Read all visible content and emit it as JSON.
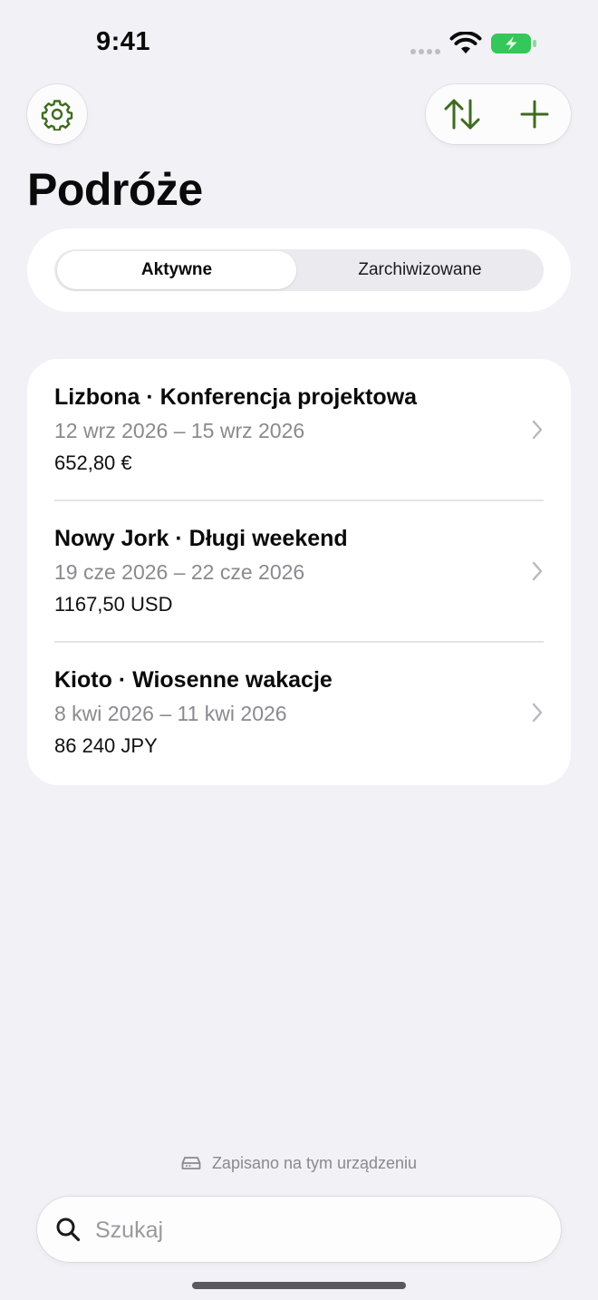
{
  "status_bar": {
    "time": "9:41"
  },
  "header": {
    "title": "Podróże",
    "settings_icon": "gear-icon",
    "sort_icon": "arrow-up-down-icon",
    "add_icon": "plus-icon"
  },
  "segments": {
    "active": "Aktywne",
    "archived": "Zarchiwizowane",
    "selected": "Aktywne"
  },
  "trips": [
    {
      "title": "Lizbona · Konferencja projektowa",
      "dates": "12 wrz 2026 – 15 wrz 2026",
      "amount": "652,80 €"
    },
    {
      "title": "Nowy Jork · Długi weekend",
      "dates": "19 cze 2026 – 22 cze 2026",
      "amount": "1167,50 USD"
    },
    {
      "title": "Kioto · Wiosenne wakacje",
      "dates": "8 kwi 2026 – 11 kwi 2026",
      "amount": "86 240 JPY"
    }
  ],
  "storage_note": {
    "text": "Zapisano na tym urządzeniu",
    "icon": "drive-icon"
  },
  "search": {
    "placeholder": "Szukaj",
    "value": ""
  },
  "colors": {
    "accent": "#3E6B1E",
    "background": "#F1F1F6",
    "battery": "#34C759"
  }
}
